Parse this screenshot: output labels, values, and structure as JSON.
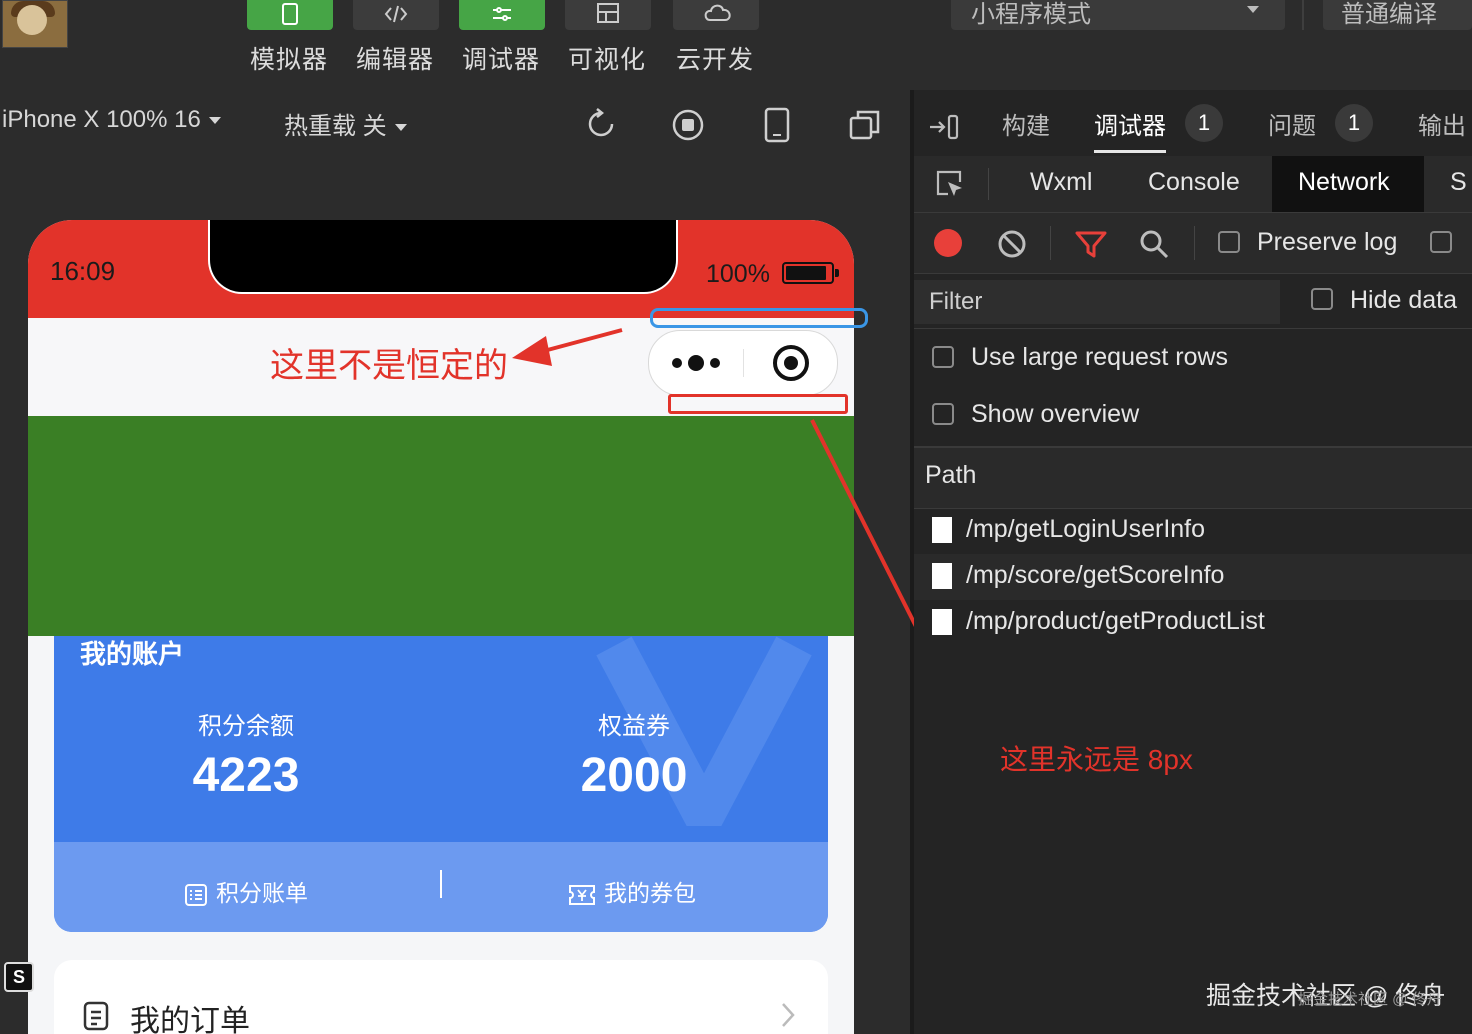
{
  "toolbar": {
    "tools": [
      {
        "label": "模拟器"
      },
      {
        "label": "编辑器"
      },
      {
        "label": "调试器"
      },
      {
        "label": "可视化"
      },
      {
        "label": "云开发"
      }
    ],
    "mode": "小程序模式",
    "compile": "普通编译"
  },
  "simulator": {
    "device": "iPhone X 100% 16",
    "hot_reload": "热重载 关"
  },
  "phone": {
    "time": "16:09",
    "battery": "100%",
    "account": {
      "title": "我的账户",
      "points_label": "积分余额",
      "points_value": "4223",
      "coupons_label": "权益券",
      "coupons_value": "2000",
      "link_bill": "积分账单",
      "link_wallet": "我的券包"
    },
    "order_title": "我的订单"
  },
  "annotations": {
    "not_fixed": "这里不是恒定的",
    "always_8px": "这里永远是 8px"
  },
  "devtools": {
    "tabs": [
      {
        "label": "构建"
      },
      {
        "label": "调试器",
        "badge": "1"
      },
      {
        "label": "问题",
        "badge": "1"
      },
      {
        "label": "输出"
      }
    ],
    "subtabs": [
      "Wxml",
      "Console",
      "Network",
      "S"
    ],
    "preserve_log": "Preserve log",
    "filter_placeholder": "Filter",
    "hide_data": "Hide data",
    "use_large_rows": "Use large request rows",
    "show_overview": "Show overview",
    "path_header": "Path",
    "requests": [
      "/mp/getLoginUserInfo",
      "/mp/score/getScoreInfo",
      "/mp/product/getProductList"
    ]
  },
  "watermark": {
    "main": "掘金技术社区 @ 佟舟",
    "small": "掘金技术社区 @ 佟舟"
  },
  "colors": {
    "status_red": "#e2332a",
    "nav_green": "#3a7f25",
    "card_blue": "#3e7be8",
    "annotation_red": "#e2332a",
    "annotation_blue": "#3a96e6"
  }
}
